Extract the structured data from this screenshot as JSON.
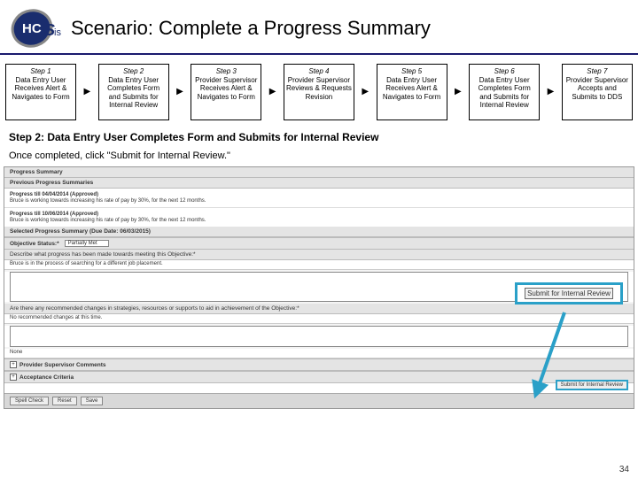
{
  "header": {
    "title": "Scenario: Complete a Progress Summary"
  },
  "logo": {
    "text1": "HC",
    "text2": "S",
    "text3": "is"
  },
  "steps": [
    {
      "num": "Step 1",
      "desc": "Data Entry User Receives Alert & Navigates to Form"
    },
    {
      "num": "Step 2",
      "desc": "Data Entry User Completes Form and Submits for Internal Review"
    },
    {
      "num": "Step 3",
      "desc": "Provider Supervisor Receives Alert & Navigates to Form"
    },
    {
      "num": "Step 4",
      "desc": "Provider Supervisor Reviews & Requests Revision"
    },
    {
      "num": "Step 5",
      "desc": "Data Entry User Receives Alert & Navigates to Form"
    },
    {
      "num": "Step 6",
      "desc": "Data Entry User Completes Form and Submits for Internal Review"
    },
    {
      "num": "Step 7",
      "desc": "Provider Supervisor Accepts and Submits to DDS"
    }
  ],
  "sub_heading": "Step 2: Data Entry User Completes Form and Submits for Internal Review",
  "instruction": "Once completed, click \"Submit for Internal Review.\"",
  "screenshot": {
    "sec1": "Progress Summary",
    "sec2": "Previous Progress Summaries",
    "sec3_title": "Progress till 04/04/2014 (Approved)",
    "sec3_body": "Bruce is working towards increasing his rate of pay by 30%, for the next 12 months.",
    "sec4_title": "Progress till 10/06/2014 (Approved)",
    "sec4_body": "Bruce is working towards increasing his rate of pay by 30%, for the next 12 months.",
    "sec5": "Selected Progress Summary (Due Date: 06/03/2015)",
    "obj_label": "Objective Status:*",
    "obj_value": "Partially Met",
    "q1": "Describe what progress has been made towards meeting this Objective:*",
    "q1_text": "Bruce is in the process of searching for a different job placement.",
    "q2": "Are there any recommended changes in strategies, resources or supports to aid in achievement of the Objective:*",
    "q2_text": "No recommended changes at this time.",
    "none": "None",
    "exp1": "Provider Supervisor Comments",
    "exp2": "Acceptance Criteria",
    "btn_spell": "Spell Check",
    "btn_reset": "Reset",
    "btn_save": "Save",
    "btn_submit": "Submit for Internal Review"
  },
  "callout": {
    "label": "Submit for Internal Review"
  },
  "page_number": "34"
}
